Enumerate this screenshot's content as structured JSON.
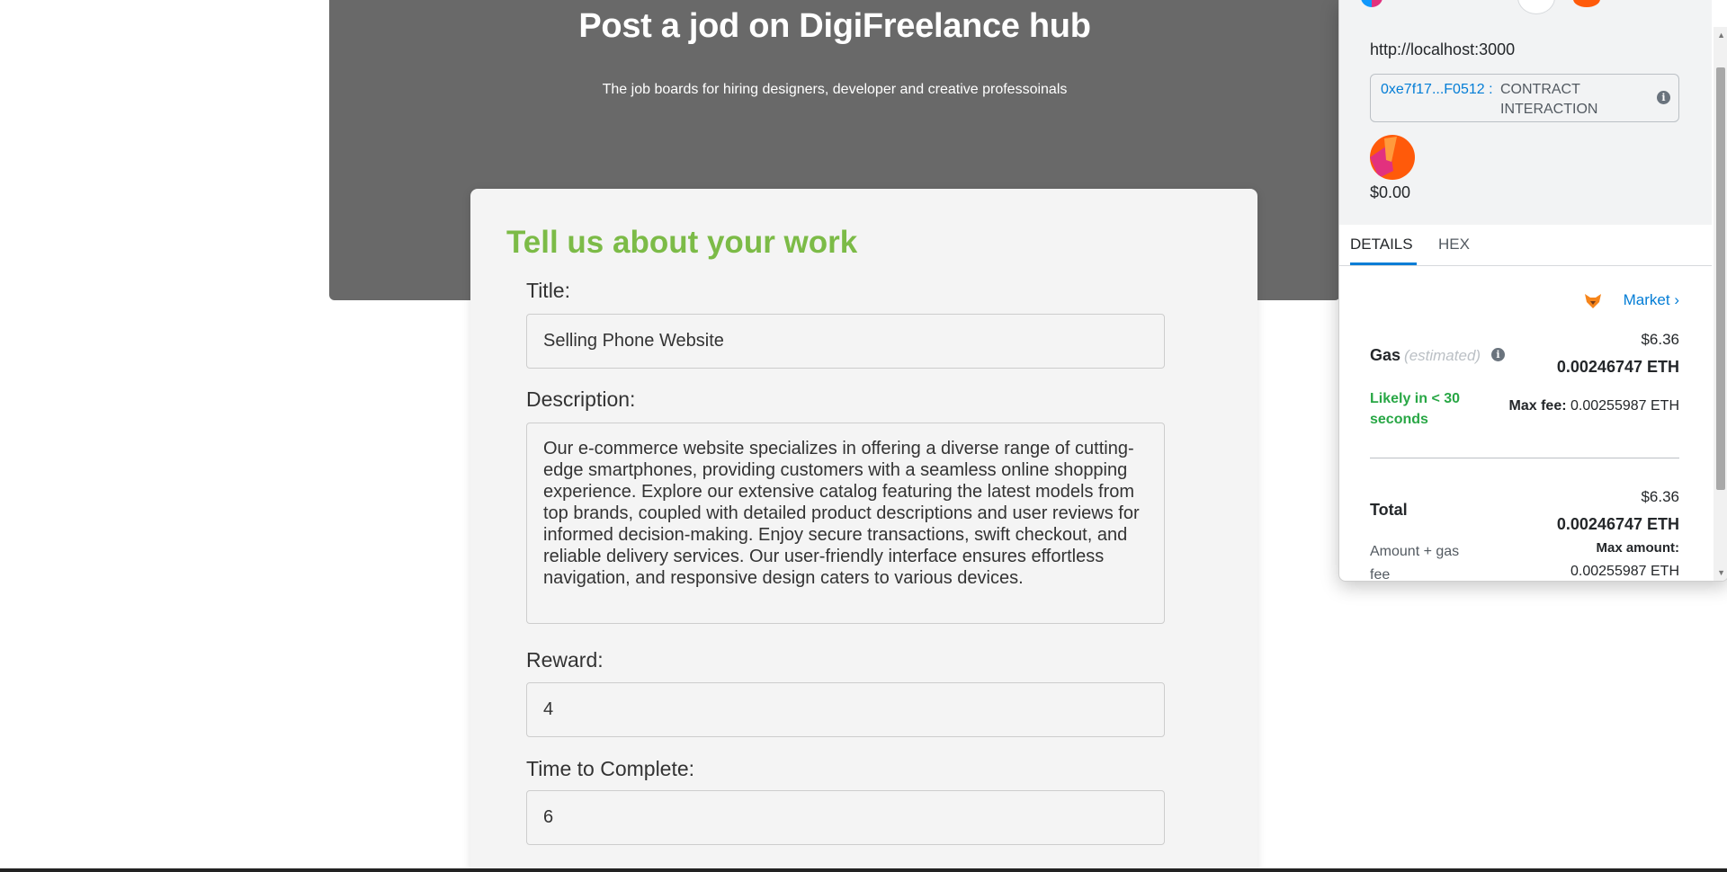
{
  "hero": {
    "title": "Post a jod on DigiFreelance hub",
    "subtitle": "The job boards for hiring designers, developer and creative professoinals"
  },
  "form": {
    "heading": "Tell us about your work",
    "title_label": "Title:",
    "title_value": "Selling Phone Website",
    "description_label": "Description:",
    "description_value": "Our e-commerce website specializes in offering a diverse range of cutting-edge smartphones, providing customers with a seamless online shopping experience. Explore our extensive catalog featuring the latest models from top brands, coupled with detailed product descriptions and user reviews for informed decision-making. Enjoy secure transactions, swift checkout, and reliable delivery services. Our user-friendly interface ensures effortless navigation, and responsive design caters to various devices.",
    "reward_label": "Reward:",
    "reward_value": "4",
    "time_label": "Time to Complete:",
    "time_value": "6"
  },
  "wallet": {
    "origin": "http://localhost:3000",
    "contract_address": "0xe7f17...F0512 :",
    "contract_label": "CONTRACT INTERACTION",
    "token_value": "$0.00",
    "tabs": [
      "DETAILS",
      "HEX"
    ],
    "market_label": "Market",
    "gas_label": "Gas",
    "gas_estimated": "(estimated)",
    "gas_usd": "$6.36",
    "gas_eth": "0.00246747 ETH",
    "likely_text": "Likely in < 30 seconds",
    "max_fee_label": "Max fee:",
    "max_fee_value": "0.00255987 ETH",
    "total_label": "Total",
    "total_usd": "$6.36",
    "total_eth": "0.00246747 ETH",
    "amount_gas_label": "Amount + gas fee",
    "max_amount_label": "Max amount:",
    "max_amount_value": "0.00255987 ETH"
  },
  "colors": {
    "hero_bg": "#696969",
    "accent_green": "#7cbb47",
    "link_blue": "#037dd6",
    "success_green": "#28a745"
  }
}
